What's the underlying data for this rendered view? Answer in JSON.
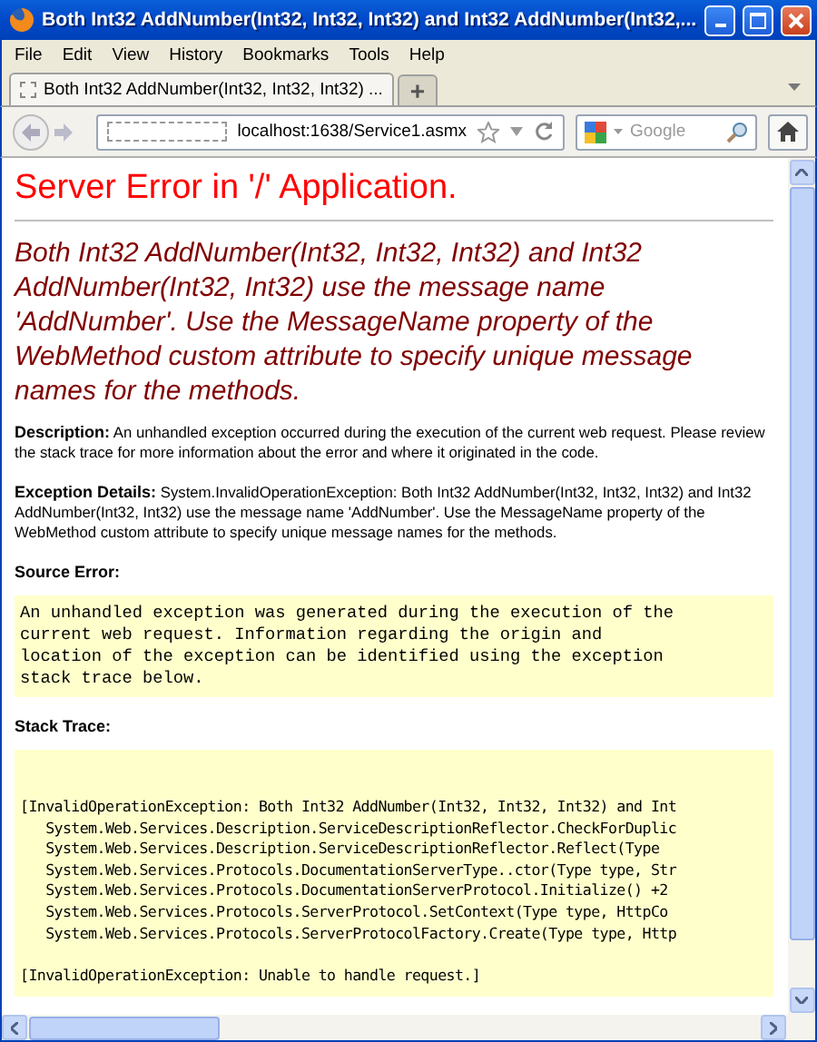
{
  "window": {
    "title": "Both Int32 AddNumber(Int32, Int32, Int32) and Int32 AddNumber(Int32,..."
  },
  "menu": [
    "File",
    "Edit",
    "View",
    "History",
    "Bookmarks",
    "Tools",
    "Help"
  ],
  "tabs": [
    {
      "label": "Both Int32 AddNumber(Int32, Int32, Int32) ...",
      "selected": true
    }
  ],
  "new_tab": "+",
  "address_bar": {
    "value": "localhost:1638/Service1.asmx"
  },
  "search": {
    "placeholder": "Google"
  },
  "page": {
    "title": "Server Error in '/' Application.",
    "message": "Both Int32 AddNumber(Int32, Int32, Int32) and Int32 AddNumber(Int32, Int32) use the message name 'AddNumber'.  Use the MessageName property of the WebMethod custom attribute to specify unique message names for the methods.",
    "sections": [
      {
        "kind": "text",
        "label": "Description:",
        "text": "An unhandled exception occurred during the execution of the current web request. Please review the stack trace for more information about the error and where it originated in the code."
      },
      {
        "kind": "text",
        "label": "Exception Details:",
        "text": "System.InvalidOperationException: Both Int32 AddNumber(Int32, Int32, Int32) and Int32 AddNumber(Int32, Int32) use the message name 'AddNumber'.  Use the MessageName property of the WebMethod custom attribute to specify unique message names for the methods."
      },
      {
        "kind": "heading",
        "label": "Source Error:"
      },
      {
        "kind": "code",
        "lines": [
          "An unhandled exception was generated during the execution of the",
          "current web request. Information regarding the origin and",
          "location of the exception can be identified using the exception",
          "stack trace below."
        ]
      },
      {
        "kind": "heading",
        "label": "Stack Trace:"
      },
      {
        "kind": "trace",
        "lines": [
          "[InvalidOperationException: Both Int32 AddNumber(Int32, Int32, Int32) and Int",
          "   System.Web.Services.Description.ServiceDescriptionReflector.CheckForDuplic",
          "   System.Web.Services.Description.ServiceDescriptionReflector.Reflect(Type",
          "   System.Web.Services.Protocols.DocumentationServerType..ctor(Type type, Str",
          "   System.Web.Services.Protocols.DocumentationServerProtocol.Initialize() +2",
          "   System.Web.Services.Protocols.ServerProtocol.SetContext(Type type, HttpCo",
          "   System.Web.Services.Protocols.ServerProtocolFactory.Create(Type type, Http"
        ],
        "final_line": "[InvalidOperationException: Unable to handle request.]"
      }
    ]
  }
}
